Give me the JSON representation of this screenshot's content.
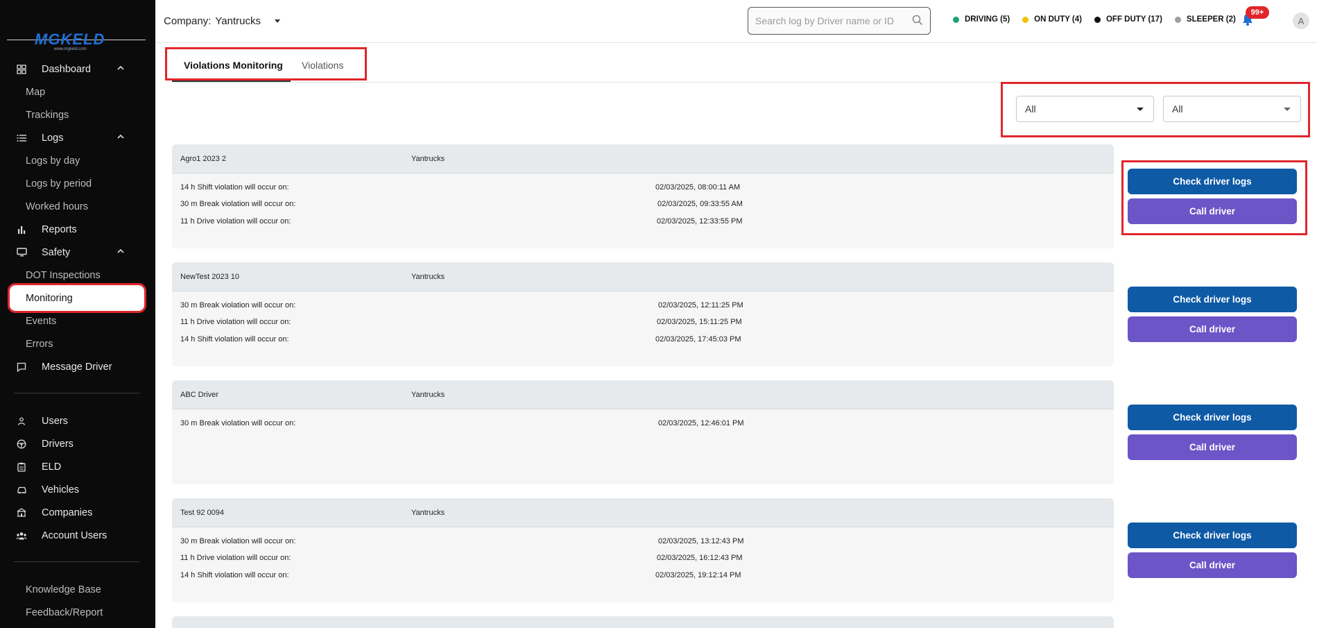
{
  "sidebar": {
    "logo_text": "MGKELD",
    "logo_sub": "www.mgkeld.com",
    "items": [
      {
        "label": "Dashboard",
        "type": "section"
      },
      {
        "label": "Map",
        "type": "sub"
      },
      {
        "label": "Trackings",
        "type": "sub"
      },
      {
        "label": "Logs",
        "type": "section"
      },
      {
        "label": "Logs by day",
        "type": "sub"
      },
      {
        "label": "Logs by period",
        "type": "sub"
      },
      {
        "label": "Worked hours",
        "type": "sub"
      },
      {
        "label": "Reports",
        "type": "item"
      },
      {
        "label": "Safety",
        "type": "section"
      },
      {
        "label": "DOT Inspections",
        "type": "sub"
      },
      {
        "label": "Monitoring",
        "type": "sub-active"
      },
      {
        "label": "Events",
        "type": "sub"
      },
      {
        "label": "Errors",
        "type": "sub"
      },
      {
        "label": "Message Driver",
        "type": "item"
      },
      {
        "label": "Users",
        "type": "item"
      },
      {
        "label": "Drivers",
        "type": "item"
      },
      {
        "label": "ELD",
        "type": "item"
      },
      {
        "label": "Vehicles",
        "type": "item"
      },
      {
        "label": "Companies",
        "type": "item"
      },
      {
        "label": "Account Users",
        "type": "item"
      },
      {
        "label": "Knowledge Base",
        "type": "sub"
      },
      {
        "label": "Feedback/Report",
        "type": "sub"
      }
    ]
  },
  "header": {
    "company_label": "Company:",
    "company_value": "Yantrucks",
    "search_placeholder": "Search log by Driver name or ID",
    "statuses": [
      {
        "label": "DRIVING (5)",
        "color": "#1aa37a"
      },
      {
        "label": "ON DUTY (4)",
        "color": "#f2c200"
      },
      {
        "label": "OFF DUTY (17)",
        "color": "#111111"
      },
      {
        "label": "SLEEPER (2)",
        "color": "#9e9e9e"
      }
    ],
    "notifications_badge": "99+",
    "avatar_initial": "A"
  },
  "tabs": [
    {
      "label": "Violations Monitoring",
      "active": true
    },
    {
      "label": "Violations",
      "active": false
    }
  ],
  "filters": [
    {
      "value": "All"
    },
    {
      "value": "All"
    }
  ],
  "cards": [
    {
      "driver": "Agro1 2023 2",
      "company": "Yantrucks",
      "violations": [
        {
          "text": "14 h Shift violation will occur on:",
          "time": "02/03/2025, 08:00:11 AM"
        },
        {
          "text": "30 m Break violation will occur on:",
          "time": "02/03/2025, 09:33:55 AM"
        },
        {
          "text": "11 h Drive violation will occur on:",
          "time": "02/03/2025, 12:33:55 PM"
        }
      ]
    },
    {
      "driver": "NewTest 2023 10",
      "company": "Yantrucks",
      "violations": [
        {
          "text": "30 m Break violation will occur on:",
          "time": "02/03/2025, 12:11:25 PM"
        },
        {
          "text": "11 h Drive violation will occur on:",
          "time": "02/03/2025, 15:11:25 PM"
        },
        {
          "text": "14 h Shift violation will occur on:",
          "time": "02/03/2025, 17:45:03 PM"
        }
      ]
    },
    {
      "driver": "ABC Driver",
      "company": "Yantrucks",
      "violations": [
        {
          "text": "30 m Break violation will occur on:",
          "time": "02/03/2025, 12:46:01 PM"
        }
      ]
    },
    {
      "driver": "Test 92 0094",
      "company": "Yantrucks",
      "violations": [
        {
          "text": "30 m Break violation will occur on:",
          "time": "02/03/2025, 13:12:43 PM"
        },
        {
          "text": "11 h Drive violation will occur on:",
          "time": "02/03/2025, 16:12:43 PM"
        },
        {
          "text": "14 h Shift violation will occur on:",
          "time": "02/03/2025, 19:12:14 PM"
        }
      ]
    }
  ],
  "actions": {
    "check_logs_label": "Check driver logs",
    "call_driver_label": "Call driver"
  },
  "colors": {
    "highlight": "#e0262b",
    "primary_button": "#0f5aa5",
    "secondary_button": "#6b55c7",
    "sidebar_bg": "#0b0b0c"
  }
}
